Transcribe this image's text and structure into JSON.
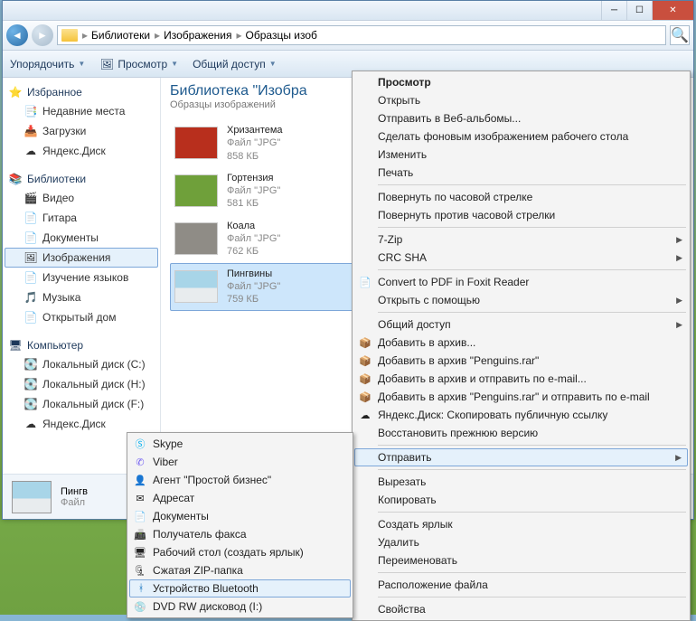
{
  "window": {
    "minimize": "─",
    "maximize": "☐",
    "close": "✕"
  },
  "nav": {
    "back": "◄",
    "forward": "►",
    "search": "🔍"
  },
  "breadcrumb": [
    "Библиотеки",
    "Изображения",
    "Образцы изоб"
  ],
  "toolbar": {
    "organize": "Упорядочить",
    "view": "Просмотр",
    "share": "Общий доступ"
  },
  "sidebar": {
    "favorites": {
      "label": "Избранное",
      "items": [
        "Недавние места",
        "Загрузки",
        "Яндекс.Диск"
      ]
    },
    "libraries": {
      "label": "Библиотеки",
      "items": [
        "Видео",
        "Гитара",
        "Документы",
        "Изображения",
        "Изучение языков",
        "Музыка",
        "Открытый дом"
      ]
    },
    "computer": {
      "label": "Компьютер",
      "items": [
        "Локальный диск (C:)",
        "Локальный диск (H:)",
        "Локальный диск (F:)",
        "Яндекс.Диск"
      ]
    }
  },
  "library": {
    "title": "Библиотека \"Изобра",
    "subtitle": "Образцы изображений"
  },
  "files": [
    {
      "name": "Хризантема",
      "type": "Файл \"JPG\"",
      "size": "858 КБ",
      "color": "#b82f1d"
    },
    {
      "name": "Гортензия",
      "type": "Файл \"JPG\"",
      "size": "581 КБ",
      "color": "#6fa03a"
    },
    {
      "name": "Коала",
      "type": "Файл \"JPG\"",
      "size": "762 КБ",
      "color": "#8f8c86"
    },
    {
      "name": "Пингвины",
      "type": "Файл \"JPG\"",
      "size": "759 КБ",
      "color": "#a8d5e8"
    }
  ],
  "preview": {
    "name": "Пингв",
    "type": "Файл"
  },
  "context": {
    "view": "Просмотр",
    "open": "Открыть",
    "send_web": "Отправить в Веб-альбомы...",
    "set_wallpaper": "Сделать фоновым изображением рабочего стола",
    "edit": "Изменить",
    "print": "Печать",
    "rotate_cw": "Повернуть по часовой стрелке",
    "rotate_ccw": "Повернуть против часовой стрелки",
    "sevenzip": "7-Zip",
    "crc": "CRC SHA",
    "foxit": "Convert to PDF in Foxit Reader",
    "open_with": "Открыть с помощью",
    "share": "Общий доступ",
    "add_archive": "Добавить в архив...",
    "add_penguins": "Добавить в архив \"Penguins.rar\"",
    "archive_email": "Добавить в архив и отправить по e-mail...",
    "penguins_email": "Добавить в архив \"Penguins.rar\" и отправить по e-mail",
    "yandex": "Яндекс.Диск: Скопировать публичную ссылку",
    "restore": "Восстановить прежнюю версию",
    "send_to": "Отправить",
    "cut": "Вырезать",
    "copy": "Копировать",
    "shortcut": "Создать ярлык",
    "delete": "Удалить",
    "rename": "Переименовать",
    "location": "Расположение файла",
    "properties": "Свойства"
  },
  "submenu": {
    "skype": "Skype",
    "viber": "Viber",
    "agent": "Агент \"Простой бизнес\"",
    "addressee": "Адресат",
    "documents": "Документы",
    "fax": "Получатель факса",
    "desktop": "Рабочий стол (создать ярлык)",
    "zip": "Сжатая ZIP-папка",
    "bluetooth": "Устройство Bluetooth",
    "dvd": "DVD RW дисковод (I:)"
  }
}
